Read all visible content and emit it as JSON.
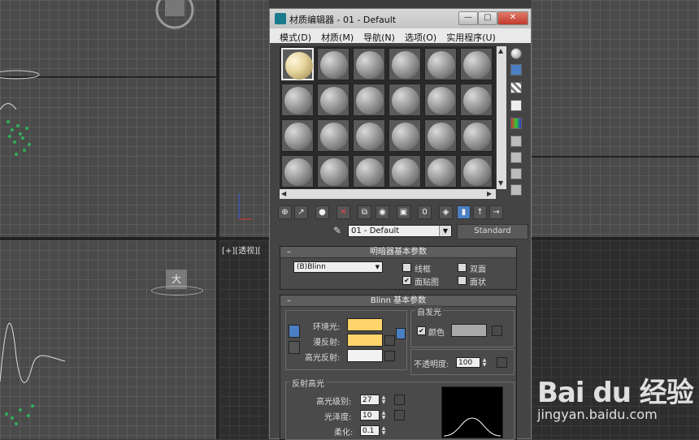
{
  "window": {
    "title": "材质编辑器 - 01 - Default",
    "min_label": "—",
    "max_label": "□",
    "close_label": "✕"
  },
  "menu": [
    "模式(D)",
    "材质(M)",
    "导航(N)",
    "选项(O)",
    "实用程序(U)"
  ],
  "slots": {
    "rows": 4,
    "cols": 6,
    "selected_index": 0
  },
  "material_name": "01 - Default",
  "material_type_button": "Standard",
  "viewport_label": "[+][透视][",
  "viewcube_label": "大",
  "shader_rollout": {
    "title": "明暗器基本参数",
    "shader": "(B)Blinn",
    "checkboxes": [
      {
        "label": "线框",
        "checked": false
      },
      {
        "label": "双面",
        "checked": false
      },
      {
        "label": "面贴图",
        "checked": true
      },
      {
        "label": "面状",
        "checked": false
      }
    ]
  },
  "blinn_rollout": {
    "title": "Blinn 基本参数",
    "ambient_label": "环境光:",
    "diffuse_label": "漫反射:",
    "specular_label": "高光反射:",
    "ambient_color": "#ffd56b",
    "diffuse_color": "#ffd56b",
    "specular_color": "#f2f2f2",
    "self_illum": {
      "title": "自发光",
      "color_label": "颜色",
      "color_checked": true,
      "swatch_color": "#a8a8a8"
    },
    "opacity_label": "不透明度:",
    "opacity_value": "100",
    "specular_highlights": {
      "title": "反射高光",
      "level_label": "高光级别:",
      "level_value": "27",
      "gloss_label": "光泽度:",
      "gloss_value": "10",
      "soften_label": "柔化:",
      "soften_value": "0.1"
    }
  },
  "watermark": {
    "logo": "Bai du 经验",
    "url": "jingyan.baidu.com"
  }
}
